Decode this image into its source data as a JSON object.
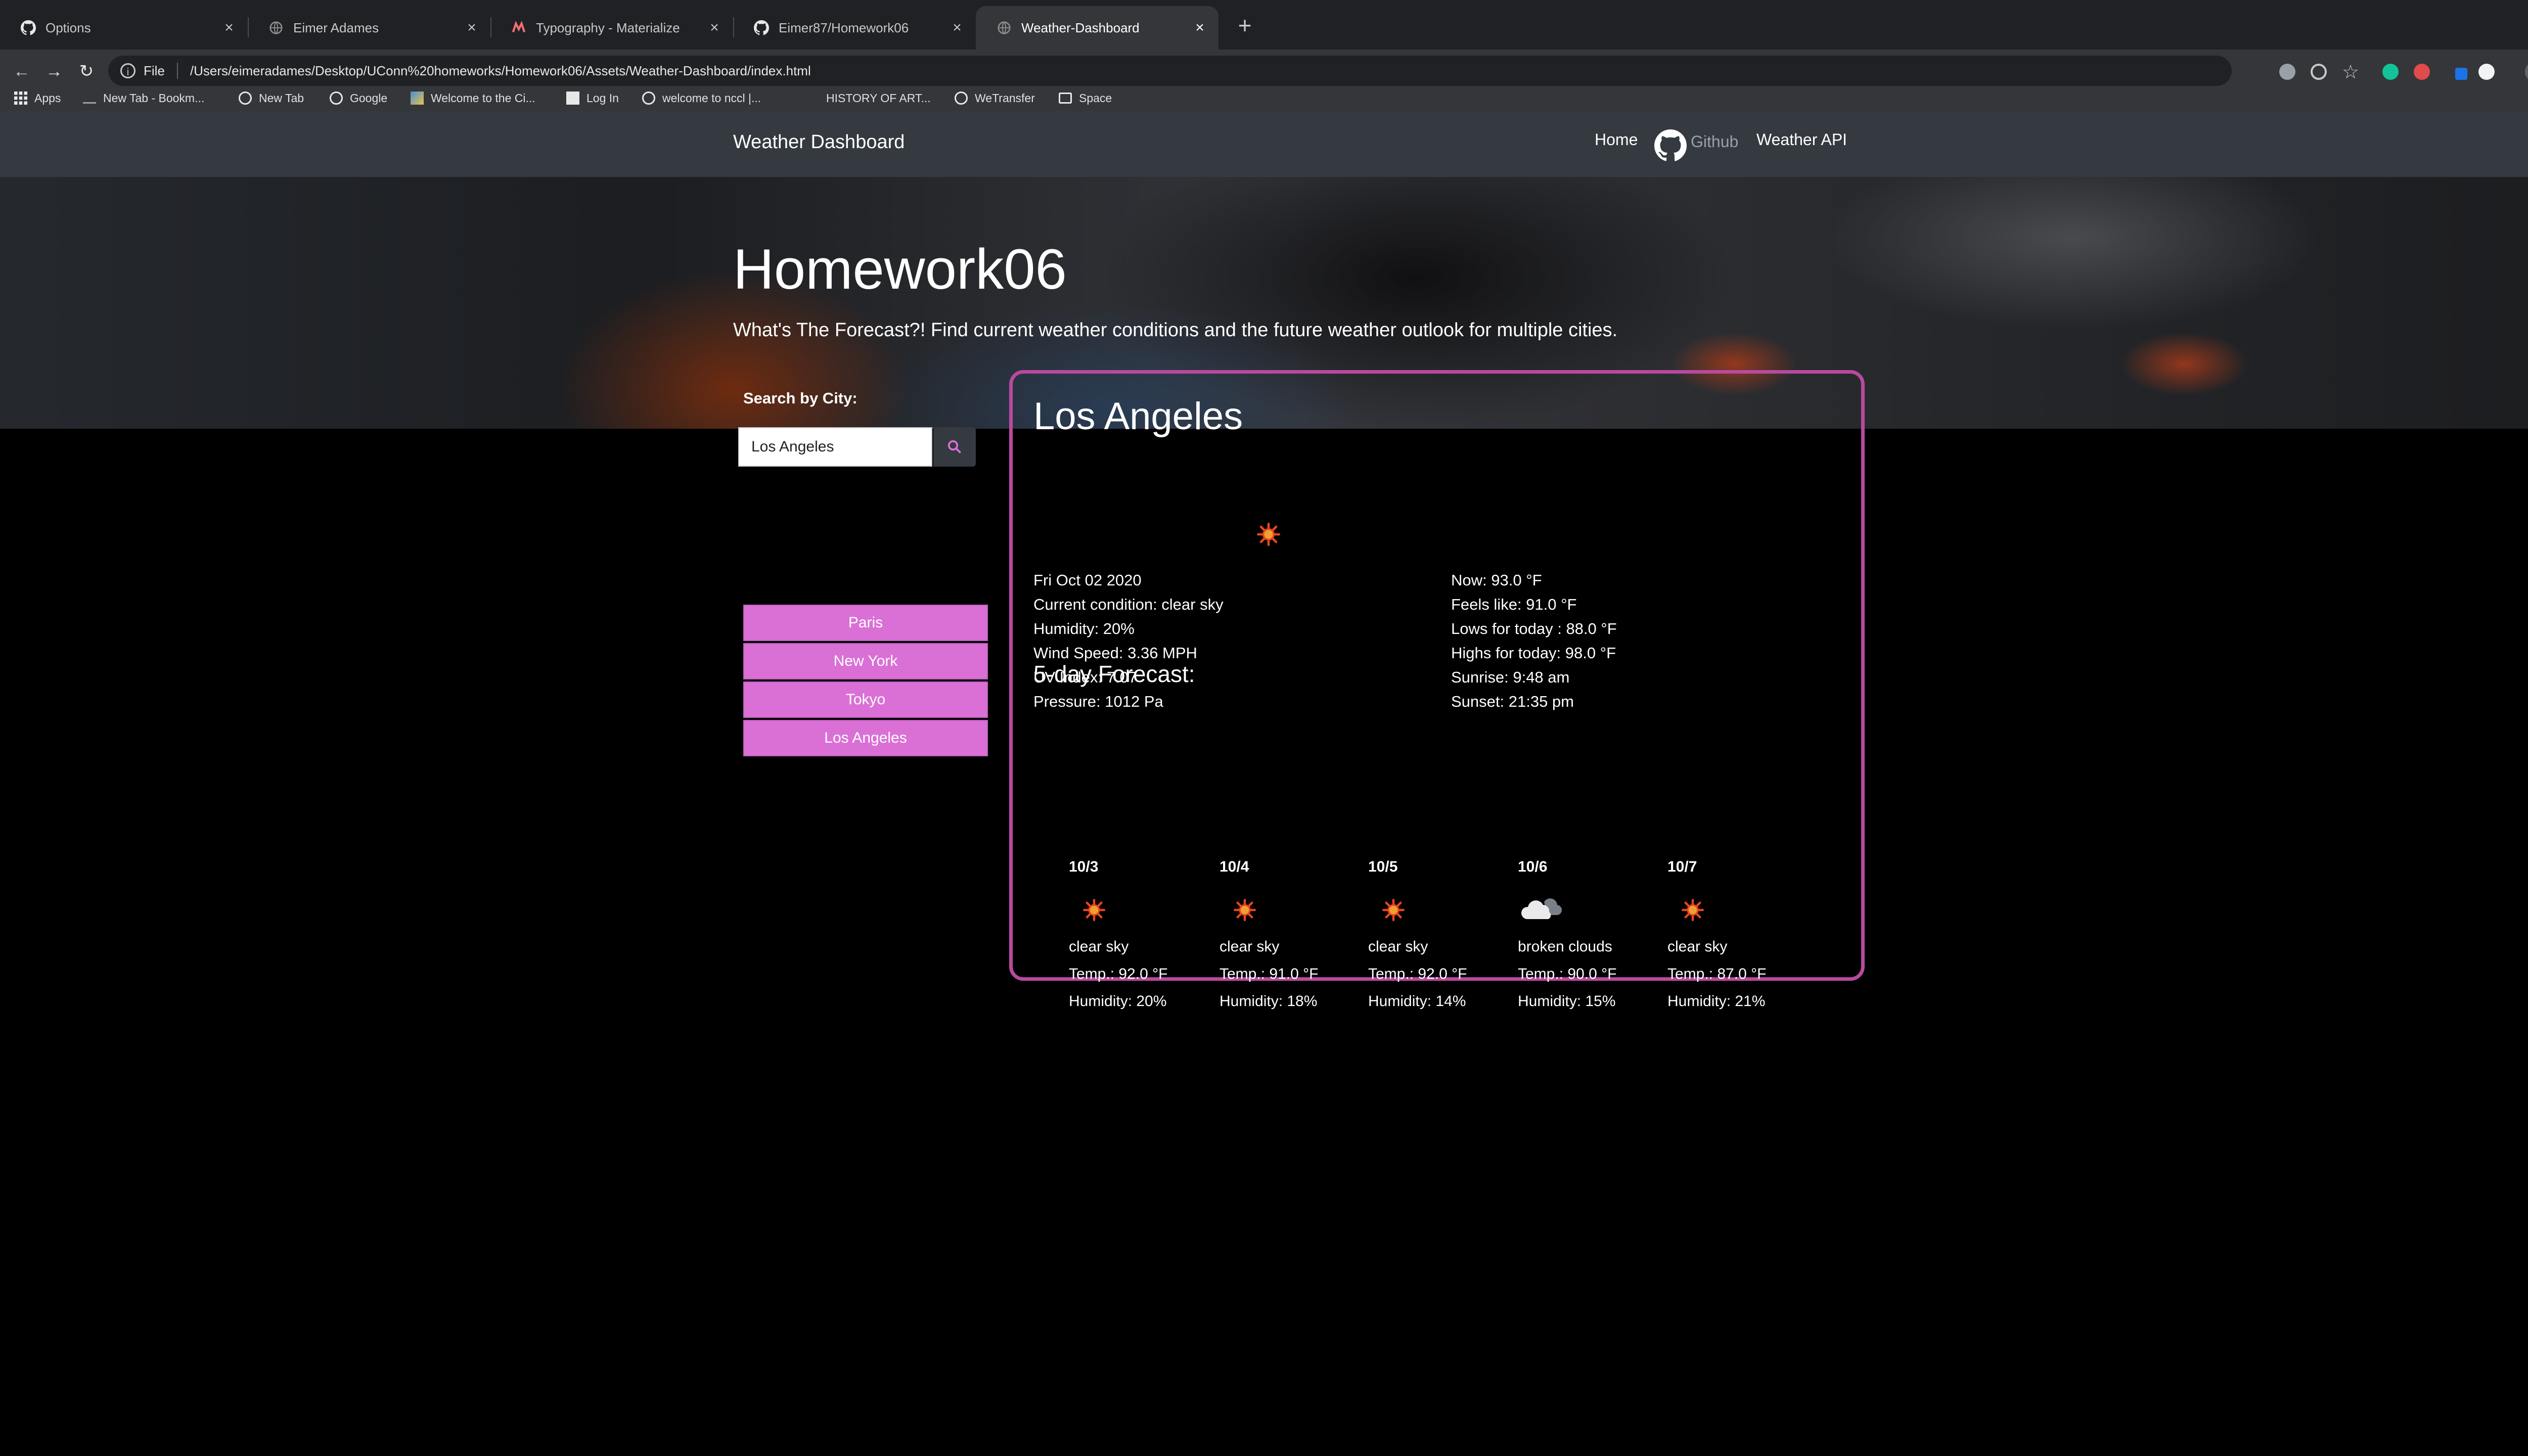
{
  "browser": {
    "tabs": [
      {
        "title": "Options",
        "icon": "github-icon"
      },
      {
        "title": "Eimer Adames",
        "icon": "globe-icon"
      },
      {
        "title": "Typography - Materialize",
        "icon": "materialize-icon"
      },
      {
        "title": "Eimer87/Homework06",
        "icon": "github-icon"
      },
      {
        "title": "Weather-Dashboard",
        "icon": "globe-icon"
      }
    ],
    "address": {
      "scheme_label": "File",
      "url": "/Users/eimeradames/Desktop/UConn%20homeworks/Homework06/Assets/Weather-Dashboard/index.html"
    },
    "bookmarks": [
      {
        "label": "Apps",
        "icon": "apps-grid-icon"
      },
      {
        "label": "New Tab - Bookm...",
        "icon": "page-icon"
      },
      {
        "label": "New Tab",
        "icon": "globe-icon"
      },
      {
        "label": "Google",
        "icon": "globe-icon"
      },
      {
        "label": "Welcome to the Ci...",
        "icon": "image-icon"
      },
      {
        "label": "Log In",
        "icon": "page-icon"
      },
      {
        "label": "welcome to nccl |...",
        "icon": "globe-icon"
      },
      {
        "label": "HISTORY OF ART...",
        "icon": "page-icon"
      },
      {
        "label": "WeTransfer",
        "icon": "globe-icon"
      },
      {
        "label": "Space",
        "icon": "folder-icon"
      }
    ]
  },
  "navbar": {
    "brand": "Weather Dashboard",
    "links": {
      "home": "Home",
      "github": "Github",
      "weather_api": "Weather API"
    }
  },
  "hero": {
    "title": "Homework06",
    "subtitle": "What's The Forecast?! Find current weather conditions and the future weather outlook for multiple cities."
  },
  "search": {
    "label": "Search by City:",
    "value": "Los Angeles",
    "history": [
      "Paris",
      "New York",
      "Tokyo",
      "Los Angeles"
    ]
  },
  "current": {
    "city": "Los Angeles",
    "icon": "sun-icon",
    "left": [
      "Fri Oct 02 2020",
      "Current condition: clear sky",
      "Humidity: 20%",
      "Wind Speed: 3.36 MPH",
      "UV Index: 7.07",
      "Pressure: 1012 Pa"
    ],
    "right": [
      "Now: 93.0 °F",
      "Feels like: 91.0 °F",
      "Lows for today : 88.0 °F",
      "Highs for today: 98.0 °F",
      "Sunrise: 9:48 am",
      "Sunset: 21:35 pm"
    ]
  },
  "forecast": {
    "title": "5-day Forecast:",
    "days": [
      {
        "date": "10/3",
        "icon": "sun-icon",
        "condition": "clear sky",
        "temp": "Temp.: 92.0 °F",
        "humidity": "Humidity: 20%"
      },
      {
        "date": "10/4",
        "icon": "sun-icon",
        "condition": "clear sky",
        "temp": "Temp.: 91.0 °F",
        "humidity": "Humidity: 18%"
      },
      {
        "date": "10/5",
        "icon": "sun-icon",
        "condition": "clear sky",
        "temp": "Temp.: 92.0 °F",
        "humidity": "Humidity: 14%"
      },
      {
        "date": "10/6",
        "icon": "cloud-icon",
        "condition": "broken clouds",
        "temp": "Temp.: 90.0 °F",
        "humidity": "Humidity: 15%"
      },
      {
        "date": "10/7",
        "icon": "sun-icon",
        "condition": "clear sky",
        "temp": "Temp.: 87.0 °F",
        "humidity": "Humidity: 21%"
      }
    ]
  },
  "colors": {
    "accent_pink": "#da70d6",
    "card_border": "#b84a9e",
    "navbar": "#343a40",
    "sun": "#e8451e"
  }
}
